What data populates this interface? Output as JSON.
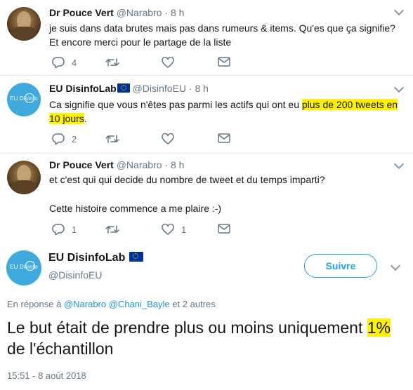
{
  "tweets": [
    {
      "name": "Dr Pouce Vert",
      "handle": "@Narabro",
      "dot": "·",
      "time": "8 h",
      "text": "je suis dans data brutes mais pas dans rumeurs & items. Qu'es que ça signifie? Et encore merci pour le partage de la liste",
      "reply_count": "4",
      "retweet_count": "",
      "like_count": ""
    },
    {
      "name": "EU DisinfoLab",
      "handle": "@DisinfoEU",
      "dot": "·",
      "time": "8 h",
      "text_before": "Ca signifie que vous n'êtes pas parmi les actifs qui ont eu ",
      "text_highlight": "plus de 200 tweets en 10 jours",
      "text_after": ".",
      "reply_count": "2",
      "retweet_count": "",
      "like_count": ""
    },
    {
      "name": "Dr Pouce Vert",
      "handle": "@Narabro",
      "dot": "·",
      "time": "8 h",
      "text_line1": "et c'est qui qui decide du nombre de tweet et du temps imparti?",
      "text_line2": "Cette histoire commence a me plaire :-)",
      "reply_count": "1",
      "retweet_count": "",
      "like_count": "1"
    }
  ],
  "main_tweet": {
    "name": "EU DisinfoLab",
    "handle": "@DisinfoEU",
    "follow_label": "Suivre",
    "reply_prefix": "En réponse à",
    "reply_user1": "@Narabro",
    "reply_user2": "@Chani_Bayle",
    "reply_suffix": "et 2 autres",
    "text_before": "Le but était de prendre plus ou moins uniquement ",
    "text_highlight": "1%",
    "text_after": " de l'échantillon",
    "timestamp": "15:51 - 8 août 2018"
  },
  "avatars": {
    "eu_logo_text": "EU Disinfo"
  },
  "colors": {
    "accent": "#1da1f2",
    "highlight": "#fff200",
    "muted": "#657786",
    "eu_avatar": "#3da9dd"
  },
  "icons": [
    "reply-icon",
    "retweet-icon",
    "like-icon",
    "message-icon",
    "chevron-down-icon",
    "eu-flag-icon"
  ]
}
